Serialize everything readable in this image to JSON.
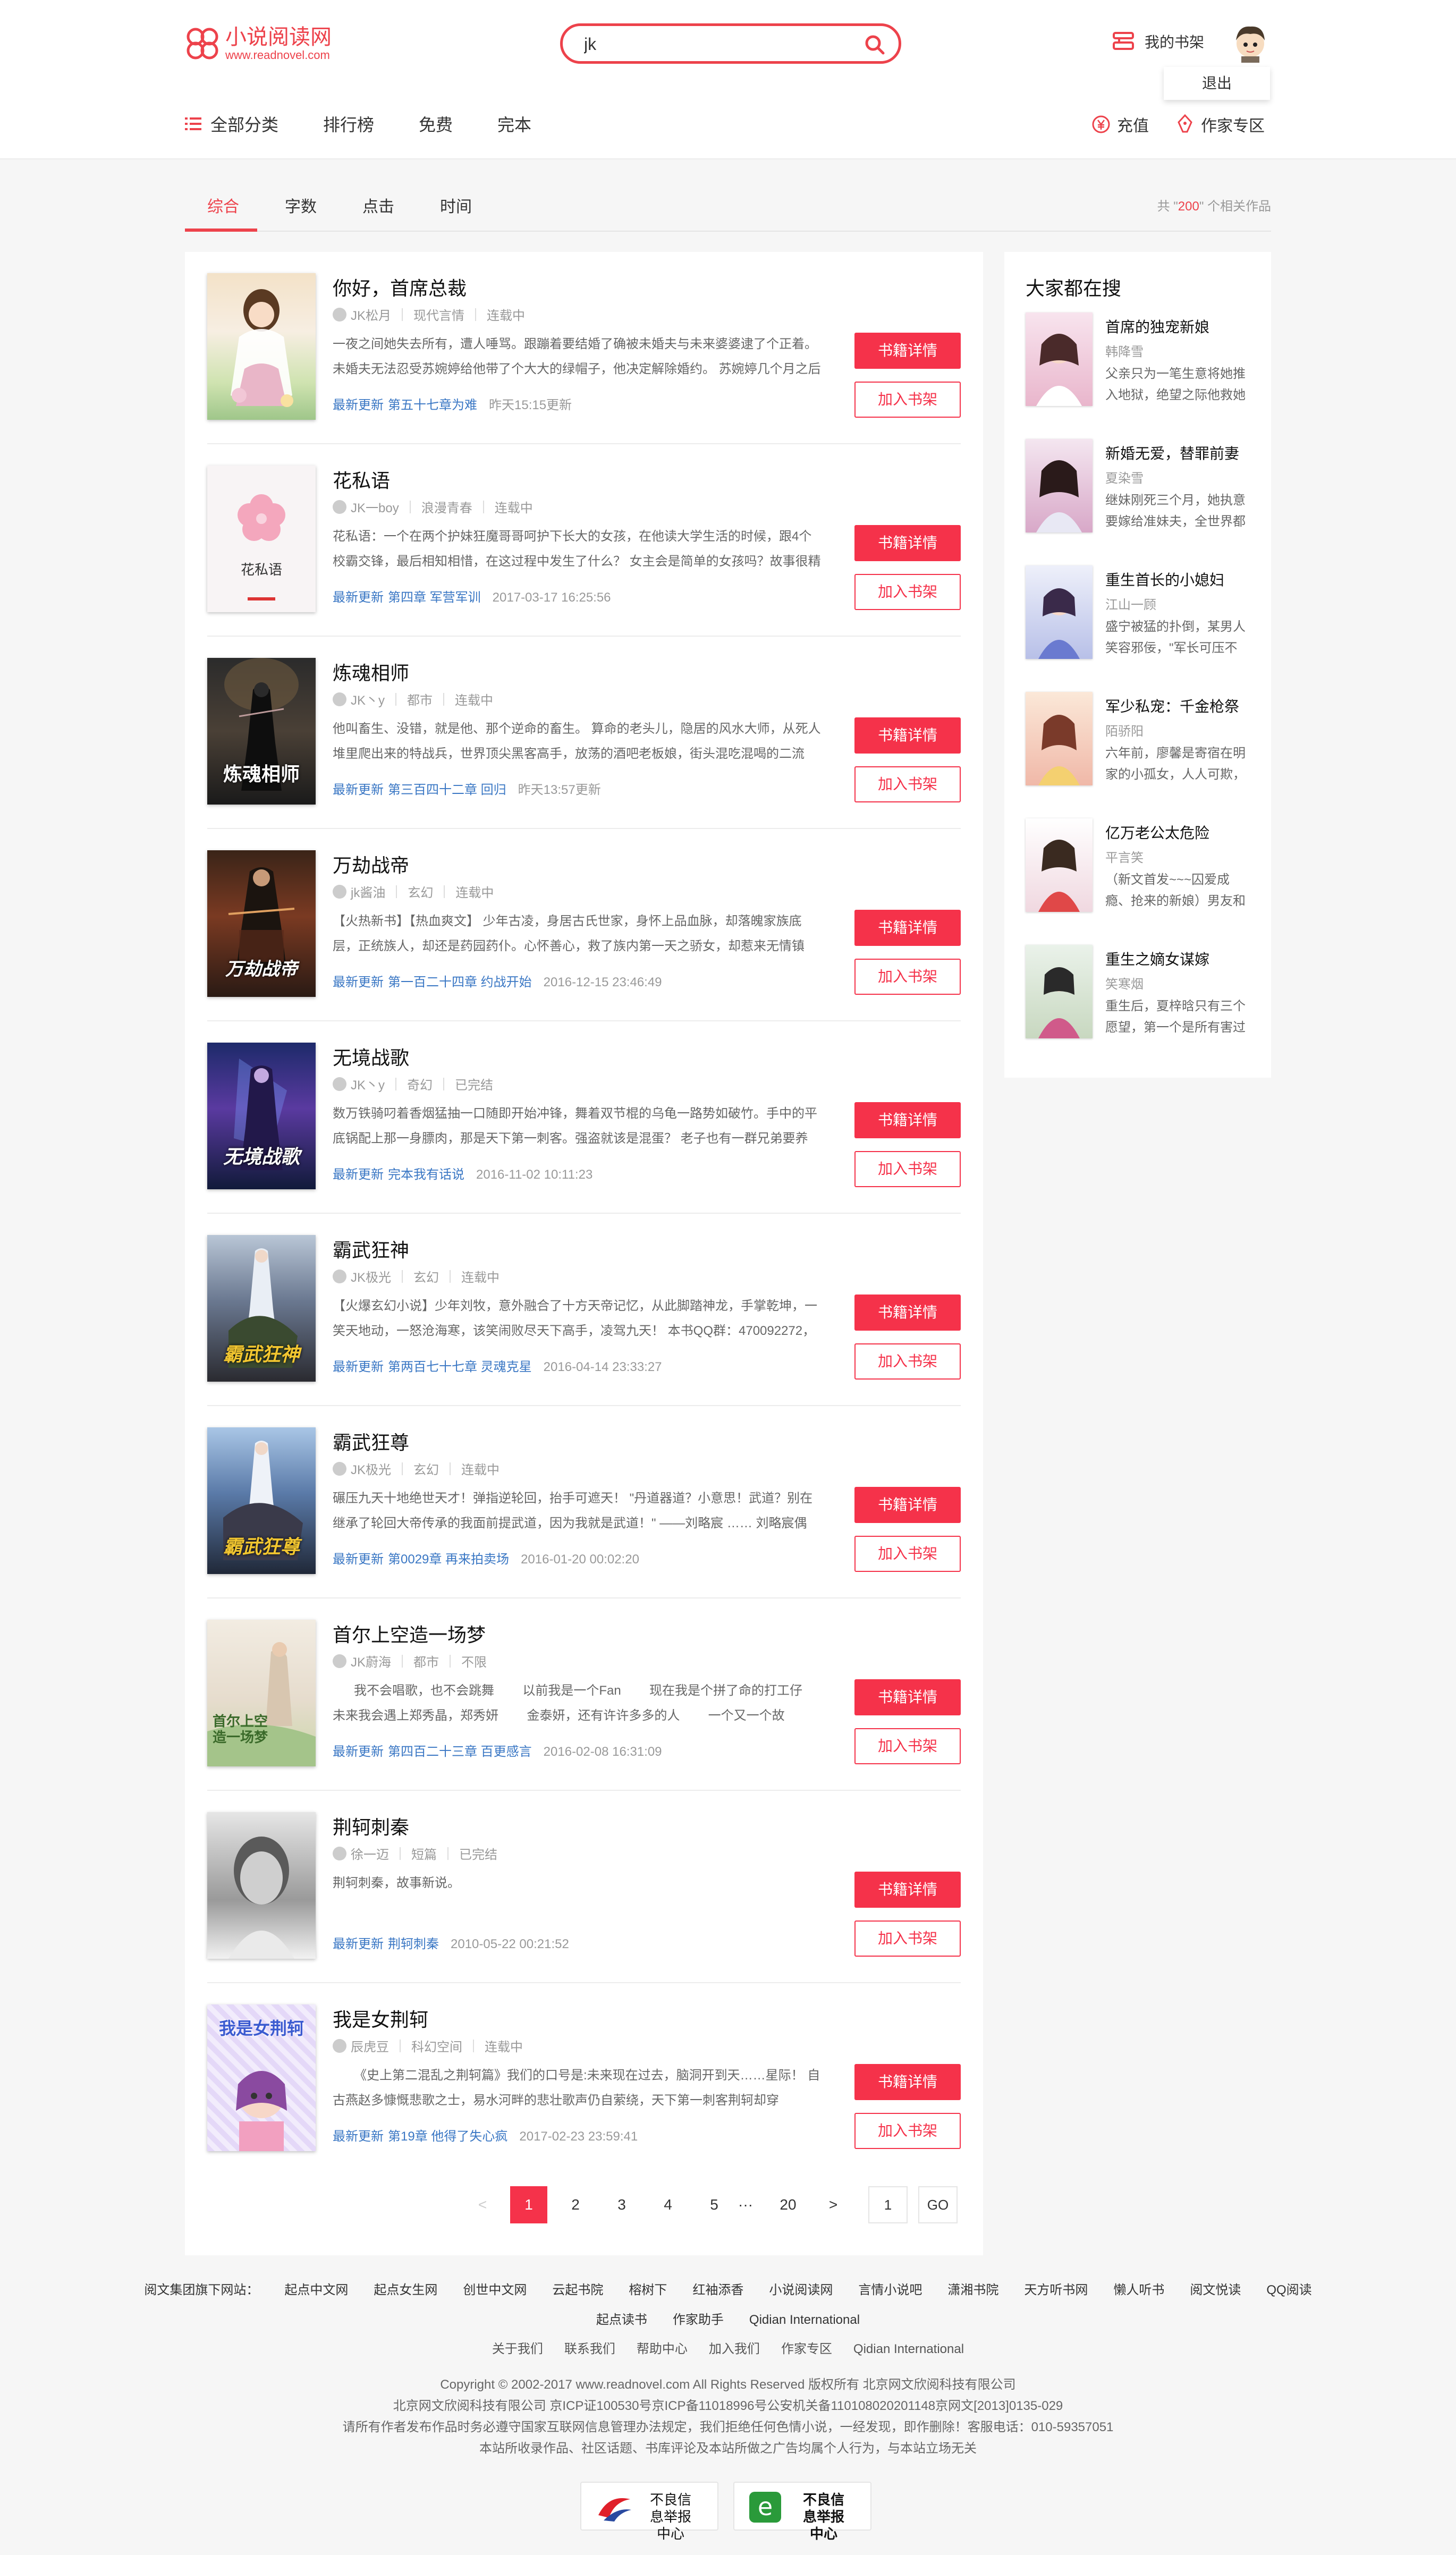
{
  "header": {
    "logo_title": "小说阅读网",
    "logo_url": "www.readnovel.com",
    "search_value": "jk",
    "shelf_label": "我的书架",
    "logout_label": "退出"
  },
  "nav": {
    "items": [
      "全部分类",
      "排行榜",
      "免费",
      "完本"
    ],
    "recharge": "充值",
    "author_zone": "作家专区"
  },
  "tabs": {
    "items": [
      "综合",
      "字数",
      "点击",
      "时间"
    ],
    "active": "综合",
    "total_prefix": "共 \"",
    "total_count": "200",
    "total_suffix": "\" 个相关作品"
  },
  "books": [
    {
      "title": "你好，首席总裁",
      "author": "JK松月",
      "category": "现代言情",
      "status": "连载中",
      "desc": "一夜之间她失去所有，遭人唾骂。跟蹦着要结婚了确被未婚夫与未来婆婆逮了个正着。未婚夫无法忍受苏婉婷给他带了个大大的绿帽子，他决定解除婚约。 苏婉婷几个月之后",
      "update_label": "最新更新",
      "chapter": "第五十七章为难",
      "time": "昨天15:15更新",
      "detail_btn": "书籍详情",
      "add_btn": "加入书架"
    },
    {
      "title": "花私语",
      "author": "JK一boy",
      "category": "浪漫青春",
      "status": "连载中",
      "desc": "花私语：一个在两个护妹狂魔哥哥呵护下长大的女孩，在他读大学生活的时候，跟4个校霸交锋，最后相知相惜，在这过程中发生了什么？ 女主会是简单的女孩吗？故事很精",
      "update_label": "最新更新",
      "chapter": "第四章 军营军训",
      "time": "2017-03-17 16:25:56",
      "detail_btn": "书籍详情",
      "add_btn": "加入书架",
      "cover_text": "花私语"
    },
    {
      "title": "炼魂相师",
      "author": "JK丶y",
      "category": "都市",
      "status": "连载中",
      "desc": "他叫畜生、没错，就是他、那个逆命的畜生。 算命的老头儿，隐居的风水大师，从死人堆里爬出来的特战兵，世界顶尖黑客高手，放荡的酒吧老板娘，街头混吃混喝的二流",
      "update_label": "最新更新",
      "chapter": "第三百四十二章 回归",
      "time": "昨天13:57更新",
      "detail_btn": "书籍详情",
      "add_btn": "加入书架",
      "cover_text": "炼魂相师"
    },
    {
      "title": "万劫战帝",
      "author": "jk酱油",
      "category": "玄幻",
      "status": "连载中",
      "desc": "【火热新书】【热血爽文】 少年古凌，身居古氏世家，身怀上品血脉，却落魄家族底层，正统族人，却还是药园药仆。心怀善心，救了族内第一天之骄女，却惹来无情镇",
      "update_label": "最新更新",
      "chapter": "第一百二十四章 约战开始",
      "time": "2016-12-15 23:46:49",
      "detail_btn": "书籍详情",
      "add_btn": "加入书架",
      "cover_text": "万劫战帝"
    },
    {
      "title": "无境战歌",
      "author": "JK丶y",
      "category": "奇幻",
      "status": "已完结",
      "desc": "数万铁骑叼着香烟猛抽一口随即开始冲锋，舞着双节棍的乌龟一路势如破竹。手中的平底锅配上那一身膘肉，那是天下第一刺客。强盗就该是混蛋？ 老子也有一群兄弟要养",
      "update_label": "最新更新",
      "chapter": "完本我有话说",
      "time": "2016-11-02 10:11:23",
      "detail_btn": "书籍详情",
      "add_btn": "加入书架",
      "cover_text": "无境战歌"
    },
    {
      "title": "霸武狂神",
      "author": "JK极光",
      "category": "玄幻",
      "status": "连载中",
      "desc": "【火爆玄幻小说】少年刘牧，意外融合了十方天帝记忆，从此脚踏神龙，手掌乾坤，一笑天地动，一怒沧海寒，该笑闹败尽天下高手，凌驾九天！ 本书QQ群：470092272，",
      "update_label": "最新更新",
      "chapter": "第两百七十七章 灵魂克星",
      "time": "2016-04-14 23:33:27",
      "detail_btn": "书籍详情",
      "add_btn": "加入书架",
      "cover_text": "霸武狂神"
    },
    {
      "title": "霸武狂尊",
      "author": "JK极光",
      "category": "玄幻",
      "status": "连载中",
      "desc": "碾压九天十地绝世天才！弹指逆轮回，抬手可遮天！ \"丹道器道？小意思！武道？别在继承了轮回大帝传承的我面前提武道，因为我就是武道！\" ——刘略宸 …… 刘略宸偶",
      "update_label": "最新更新",
      "chapter": "第0029章 再来拍卖场",
      "time": "2016-01-20 00:02:20",
      "detail_btn": "书籍详情",
      "add_btn": "加入书架",
      "cover_text": "霸武狂尊"
    },
    {
      "title": "首尔上空造一场梦",
      "author": "JK蔚海",
      "category": "都市",
      "status": "不限",
      "desc": "      我不会唱歌，也不会跳舞        以前我是一个Fan        现在我是个拼了命的打工仔       未来我会遇上郑秀晶，郑秀妍        金泰妍，还有许许多多的人        一个又一个故",
      "update_label": "最新更新",
      "chapter": "第四百二十三章 百更感言",
      "time": "2016-02-08 16:31:09",
      "detail_btn": "书籍详情",
      "add_btn": "加入书架",
      "cover_text": "首尔上空造一场梦"
    },
    {
      "title": "荆轲刺秦",
      "author": "徐一迈",
      "category": "短篇",
      "status": "已完结",
      "desc": "荆轲刺秦，故事新说。",
      "update_label": "最新更新",
      "chapter": "荆轲刺秦",
      "time": "2010-05-22 00:21:52",
      "detail_btn": "书籍详情",
      "add_btn": "加入书架"
    },
    {
      "title": "我是女荆轲",
      "author": "辰虎豆",
      "category": "科幻空间",
      "status": "连载中",
      "desc": "      《史上第二混乱之荆轲篇》我们的口号是:未来现在过去，脑洞开到天……星际！ 自古燕赵多慷慨悲歌之士，易水河畔的悲壮歌声仍自萦绕，天下第一刺客荆轲却穿",
      "update_label": "最新更新",
      "chapter": "第19章 他得了失心疯",
      "time": "2017-02-23 23:59:41",
      "detail_btn": "书籍详情",
      "add_btn": "加入书架",
      "cover_text": "我是女荆轲"
    }
  ],
  "pagination": {
    "prev": "<",
    "pages": [
      "1",
      "2",
      "3",
      "4",
      "5"
    ],
    "ellipsis": "···",
    "last": "20",
    "next": ">",
    "jump_value": "1",
    "go": "GO"
  },
  "sidebar": {
    "title": "大家都在搜",
    "items": [
      {
        "title": "首席的独宠新娘",
        "author": "韩降雪",
        "desc": "父亲只为一笔生意将她推入地狱，绝望之际他救她"
      },
      {
        "title": "新婚无爱，替罪前妻",
        "author": "夏染雪",
        "desc": "继妹刚死三个月，她执意要嫁给准妹夫，全世界都"
      },
      {
        "title": "重生首长的小媳妇",
        "author": "江山一顾",
        "desc": "盛宁被猛的扑倒，某男人笑容邪佞，\"军长可压不"
      },
      {
        "title": "军少私宠：千金枪祭",
        "author": "陌骄阳",
        "desc": "六年前，廖馨是寄宿在明家的小孤女，人人可欺，"
      },
      {
        "title": "亿万老公太危险",
        "author": "平言笑",
        "desc": "（新文首发~~~囚爱成瘾、抢来的新娘）男友和"
      },
      {
        "title": "重生之嫡女谋嫁",
        "author": "笑寒烟",
        "desc": "重生后，夏梓晗只有三个愿望，第一个是所有害过"
      }
    ]
  },
  "footer": {
    "group_label": "阅文集团旗下网站：",
    "group_links": [
      "起点中文网",
      "起点女生网",
      "创世中文网",
      "云起书院",
      "榕树下",
      "红袖添香",
      "小说阅读网",
      "言情小说吧",
      "潇湘书院",
      "天方听书网",
      "懒人听书",
      "阅文悦读",
      "QQ阅读",
      "起点读书",
      "作家助手",
      "Qidian International"
    ],
    "links": [
      "关于我们",
      "联系我们",
      "帮助中心",
      "加入我们",
      "作家专区",
      "Qidian International"
    ],
    "copyright": "Copyright © 2002-2017 www.readnovel.com All Rights Reserved 版权所有 北京网文欣阅科技有限公司",
    "icp": "北京网文欣阅科技有限公司 京ICP证100530号京ICP备11018996号公安机关备110108020201148京网文[2013]0135-029",
    "notice": "请所有作者发布作品时务必遵守国家互联网信息管理办法规定，我们拒绝任何色情小说，一经发现，即作删除！客服电话：010-59357051",
    "disclaimer": "本站所收录作品、社区话题、书库评论及本站所做之广告均属个人行为，与本站立场无关",
    "badge1": "不良信息举报中心",
    "badge2": "不良信息举报中心"
  },
  "colors": {
    "accent": "#f5324a",
    "link": "#3a77c4",
    "logo": "#ed424b"
  }
}
